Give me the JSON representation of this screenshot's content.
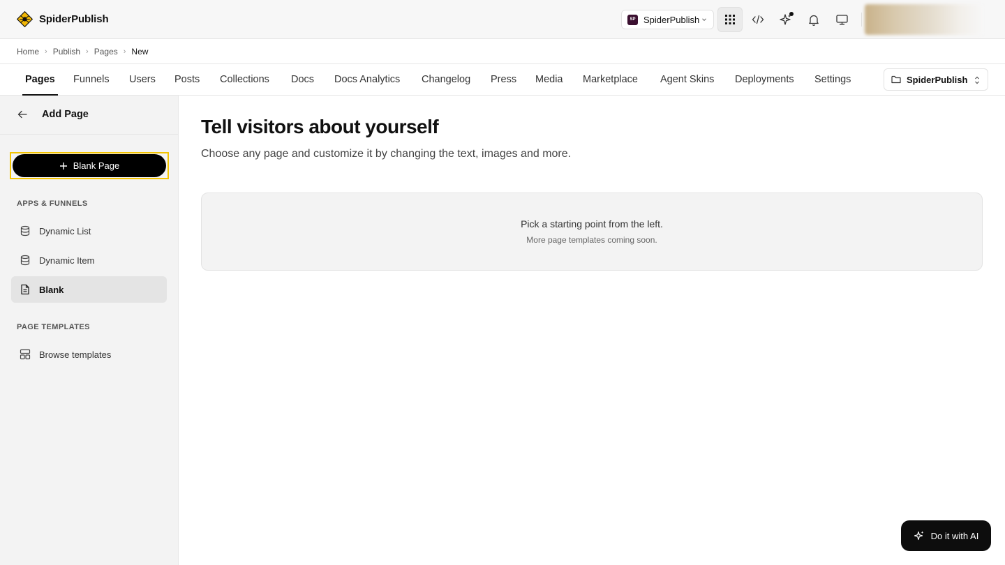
{
  "app": {
    "name": "SpiderPublish"
  },
  "topbar": {
    "workspace": {
      "badge": "SP",
      "name": "SpiderPublish"
    },
    "icons": [
      "apps-grid-icon",
      "code-icon",
      "sparkle-icon",
      "bell-icon",
      "monitor-icon"
    ]
  },
  "breadcrumb": [
    "Home",
    "Publish",
    "Pages",
    "New"
  ],
  "tabs": [
    {
      "label": "Pages",
      "active": true
    },
    {
      "label": "Funnels"
    },
    {
      "label": "Users"
    },
    {
      "label": "Posts"
    },
    {
      "label": "Collections"
    },
    {
      "label": "Docs"
    },
    {
      "label": "Docs Analytics"
    },
    {
      "label": "Changelog"
    },
    {
      "label": "Press"
    },
    {
      "label": "Media"
    },
    {
      "label": "Marketplace"
    },
    {
      "label": "Agent Skins"
    },
    {
      "label": "Deployments"
    },
    {
      "label": "Settings"
    }
  ],
  "project_select": {
    "name": "SpiderPublish"
  },
  "sidebar": {
    "title": "Add Page",
    "blank_button": "Blank Page",
    "sections": [
      {
        "heading": "APPS & FUNNELS",
        "items": [
          {
            "label": "Dynamic List",
            "icon": "database-icon"
          },
          {
            "label": "Dynamic Item",
            "icon": "database-icon"
          },
          {
            "label": "Blank",
            "icon": "document-icon",
            "selected": true
          }
        ]
      },
      {
        "heading": "PAGE TEMPLATES",
        "items": [
          {
            "label": "Browse templates",
            "icon": "templates-icon"
          }
        ]
      }
    ]
  },
  "main": {
    "title": "Tell visitors about yourself",
    "subtitle": "Choose any page and customize it by changing the text, images and more.",
    "placeholder_main": "Pick a starting point from the left.",
    "placeholder_sub": "More page templates coming soon."
  },
  "ai_button": {
    "label": "Do it with AI"
  },
  "colors": {
    "highlight": "#f3c300",
    "primary": "#000000",
    "logo": "#f2b705"
  }
}
